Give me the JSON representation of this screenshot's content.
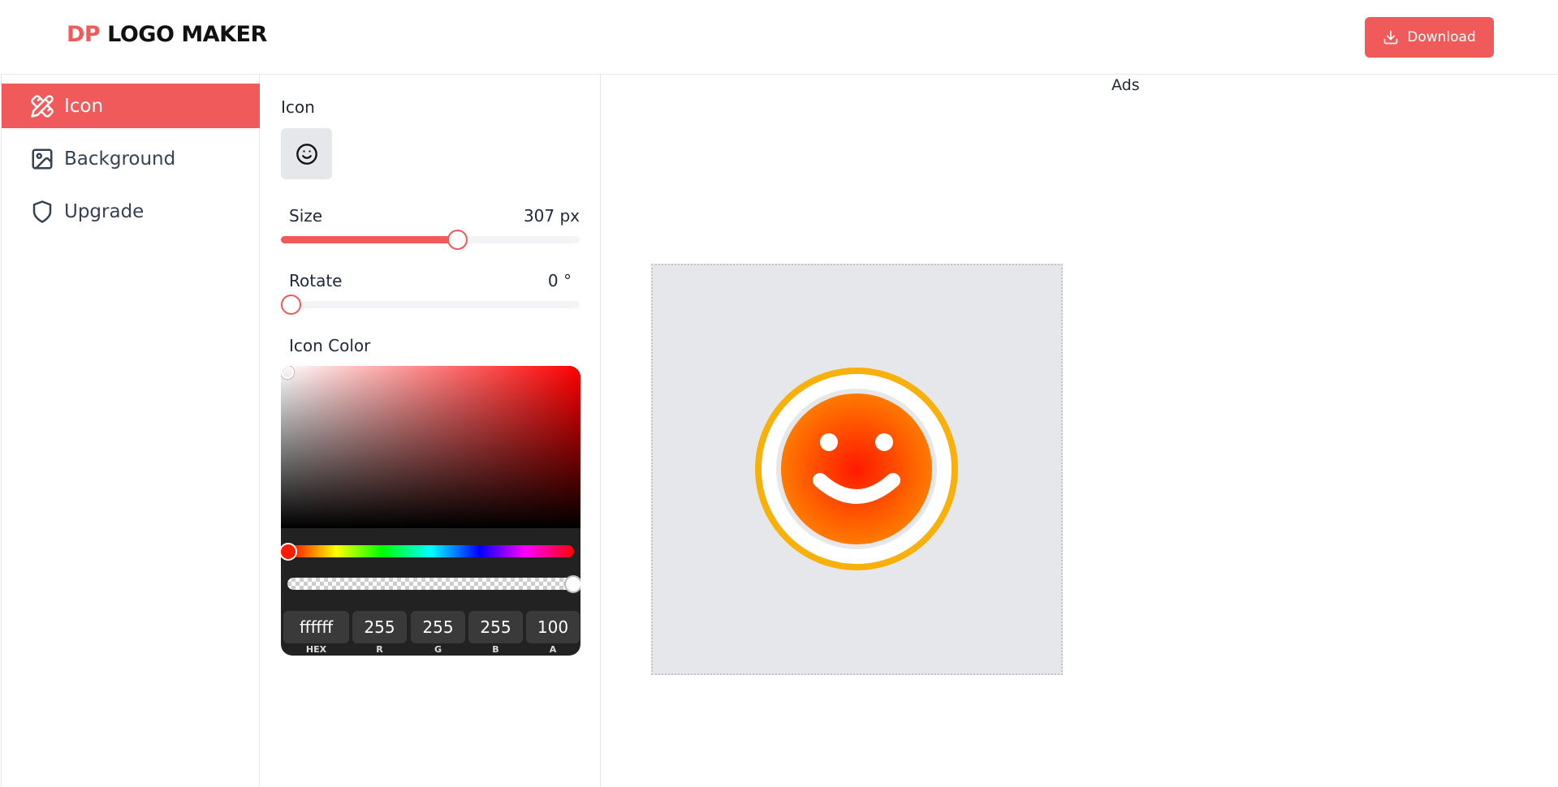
{
  "header": {
    "logo_accent": "DP",
    "logo_main": "LOGO MAKER",
    "download_label": "Download"
  },
  "sidebar": {
    "items": [
      {
        "label": "Icon",
        "icon": "pen-ruler-icon",
        "active": true
      },
      {
        "label": "Background",
        "icon": "image-icon",
        "active": false
      },
      {
        "label": "Upgrade",
        "icon": "shield-icon",
        "active": false
      }
    ]
  },
  "panel": {
    "icon_label": "Icon",
    "icon_name": "smile-icon",
    "size_label": "Size",
    "size_value": "307 px",
    "rotate_label": "Rotate",
    "rotate_value": "0 °",
    "color_label": "Icon Color"
  },
  "color_picker": {
    "hex": "ffffff",
    "r": "255",
    "g": "255",
    "b": "255",
    "a": "100",
    "hex_label": "HEX",
    "r_label": "R",
    "g_label": "G",
    "b_label": "B",
    "a_label": "A"
  },
  "preview": {
    "ads_label": "Ads"
  },
  "colors": {
    "accent": "#f05a5a",
    "canvas_bg": "#e5e7eb",
    "icon_ring": "#f8b00a",
    "icon_gradient_center": "#ff1a00",
    "icon_gradient_edge": "#ff7a00"
  }
}
